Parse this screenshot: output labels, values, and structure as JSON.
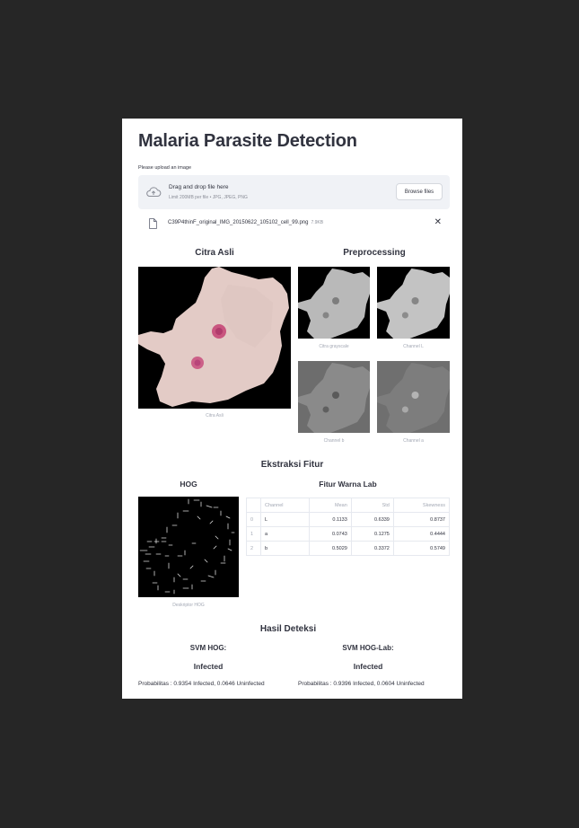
{
  "title": "Malaria Parasite Detection",
  "upload": {
    "label": "Please upload an image",
    "drag_text": "Drag and drop file here",
    "limit_text": "Limit 200MB per file • JPG, JPEG, PNG",
    "browse_label": "Browse files",
    "file_name": "C39P4thinF_original_IMG_20150622_105102_cell_99.png",
    "file_size": "7.9KB",
    "close_glyph": "✕",
    "icons": {
      "upload": "cloud-upload-icon",
      "file": "file-icon",
      "close": "close-icon"
    }
  },
  "original": {
    "header": "Citra Asli",
    "caption": "Citra Asli"
  },
  "preprocessing": {
    "header": "Preprocessing",
    "captions": [
      "Citra grayscale",
      "Channel L",
      "Channel b",
      "Channel a"
    ]
  },
  "features": {
    "header": "Ekstraksi Fitur",
    "hog_header": "HOG",
    "hog_caption": "Deskriptor HOG",
    "lab_header": "Fitur Warna Lab",
    "table": {
      "columns": [
        "",
        "Channel",
        "Mean",
        "Std",
        "Skewness"
      ],
      "rows": [
        [
          "0",
          "L",
          "0.1133",
          "0.6339",
          "0.8737"
        ],
        [
          "1",
          "a",
          "0.0743",
          "0.1275",
          "0.4444"
        ],
        [
          "2",
          "b",
          "0.5029",
          "0.3372",
          "0.5749"
        ]
      ]
    }
  },
  "results": {
    "header": "Hasil Deteksi",
    "svm_hog": {
      "label": "SVM HOG:",
      "value": "Infected",
      "probability": "Probabilitas : 0.9354 Infected, 0.0646 Uninfected"
    },
    "svm_hog_lab": {
      "label": "SVM HOG-Lab:",
      "value": "Infected",
      "probability": "Probabilitas : 0.9396 Infected, 0.0604 Uninfected"
    }
  },
  "colors": {
    "background": "#262626",
    "page": "#ffffff",
    "text": "#31333f",
    "muted": "#a3a8b4",
    "dropzone": "#f0f2f6",
    "cell_pink": "#e2c9c4",
    "parasite": "#c04a7a"
  }
}
